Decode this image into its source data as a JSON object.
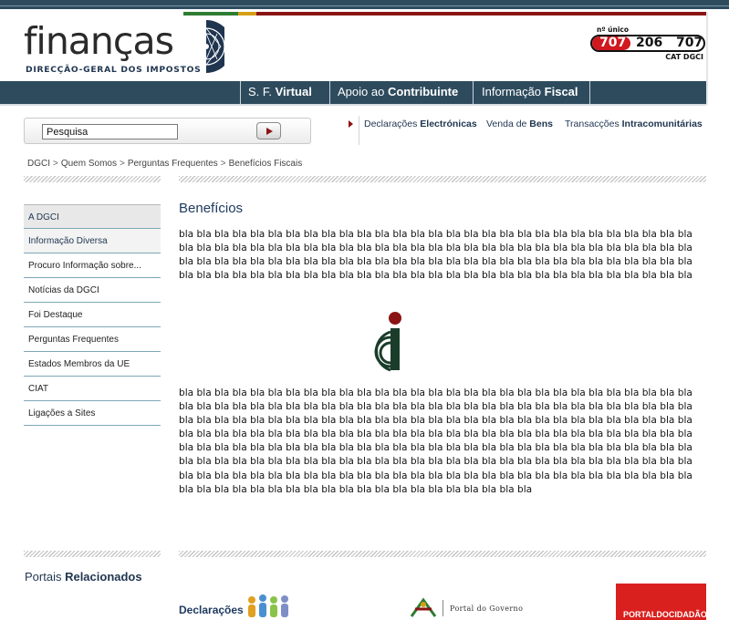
{
  "header": {
    "logo_word": "finanças",
    "logo_subtitle": "DIRECÇÃO-GERAL DOS IMPOSTOS",
    "phone": {
      "label": "nº único",
      "part1": "707",
      "part2": "206",
      "part3": "707",
      "caption": "CAT DGCI"
    },
    "colors": {
      "navy": "#2e4b5e",
      "red": "#8a1414",
      "green": "#2e7d32",
      "yellow": "#d4a017"
    }
  },
  "nav": {
    "items": [
      {
        "pre": "S. F. ",
        "bold": "Virtual"
      },
      {
        "pre": "Apoio ao ",
        "bold": "Contribuinte"
      },
      {
        "pre": "Informação ",
        "bold": "Fiscal"
      }
    ]
  },
  "search": {
    "value": "Pesquisa"
  },
  "quick_links": [
    {
      "pre": "Declarações ",
      "bold": "Electrónicas"
    },
    {
      "pre": "Venda de ",
      "bold": "Bens"
    },
    {
      "pre": "Transacções ",
      "bold": "Intracomunitárias"
    }
  ],
  "breadcrumb": [
    "DGCI",
    "Quem Somos",
    "Perguntas Frequentes",
    "Benefícios Fiscais"
  ],
  "breadcrumb_sep": ">",
  "sidebar": {
    "items": [
      {
        "label": "A DGCI"
      },
      {
        "label": "Informação Diversa"
      },
      {
        "label": "Procuro Informação sobre..."
      },
      {
        "label": "Notícias da DGCI"
      },
      {
        "label": "Foi Destaque"
      },
      {
        "label": "Perguntas Frequentes"
      },
      {
        "label": "Estados Membros da UE"
      },
      {
        "label": "CIAT"
      },
      {
        "label": "Ligações a Sites"
      }
    ]
  },
  "main": {
    "title": "Benefícios",
    "paragraph1": "bla bla bla bla bla bla bla bla bla bla bla bla bla bla bla bla bla bla bla bla bla bla bla bla bla bla bla bla bla bla bla bla bla bla bla bla bla bla bla bla bla bla bla bla bla bla bla bla bla bla bla bla bla bla bla bla bla bla bla bla bla bla bla bla bla bla bla bla bla bla bla bla bla bla bla bla bla bla bla bla bla bla bla bla bla bla bla bla bla bla bla bla bla bla bla bla bla bla bla bla bla bla bla bla bla bla bla bla bla bla bla bla bla bla bla bla",
    "paragraph2": "bla bla bla bla bla bla bla bla bla bla bla bla bla bla bla bla bla bla bla bla bla bla bla bla bla bla bla bla bla bla bla bla bla bla bla bla bla bla bla bla bla bla bla bla bla bla bla bla bla bla bla bla bla bla bla bla bla bla bla bla bla bla bla bla bla bla bla bla bla bla bla bla bla bla bla bla bla bla bla bla bla bla bla bla bla bla bla bla bla bla bla bla bla bla bla bla bla bla bla bla bla bla bla bla bla bla bla bla bla bla bla bla bla bla bla bla bla bla bla bla bla bla bla bla bla bla bla bla bla bla bla bla bla bla bla bla bla bla bla bla bla bla bla bla bla bla bla bla bla bla bla bla bla bla bla bla bla bla bla bla bla bla bla bla bla bla bla bla bla bla bla bla bla bla bla bla bla bla bla bla bla bla bla bla bla bla bla bla bla bla bla bla bla bla bla bla bla bla bla bla bla bla bla bla bla bla bla bla bla bla bla bla bla bla bla bla bla bla bla bla bla bla bla"
  },
  "footer": {
    "portais_pre": "Portais ",
    "portais_bold": "Relacionados",
    "declaracoes_label": "Declarações",
    "governo_label": "Portal do Governo",
    "cidadao_label": "PORTALDOCIDADÃO"
  }
}
